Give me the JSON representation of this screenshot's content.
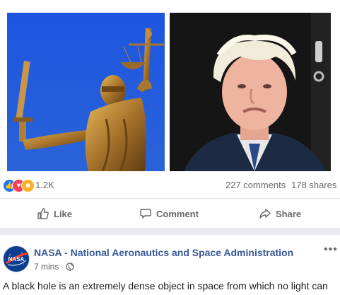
{
  "post": {
    "reactions": {
      "icons": [
        "like-reaction",
        "love-reaction",
        "haha-reaction"
      ],
      "count": "1.2K",
      "comments": "227 comments",
      "shares": "178 shares"
    },
    "actions": {
      "like": "Like",
      "comment": "Comment",
      "share": "Share"
    }
  },
  "next_post": {
    "author": "NASA - National Aeronautics and Space Administration",
    "time": "7 mins",
    "separator": "·",
    "body": "A black hole is an extremely dense object in space from which no light can"
  },
  "colors": {
    "link": "#385898",
    "like": "#1877f2",
    "love": "#f33e58",
    "haha": "#f7b125",
    "muted": "#65676b"
  }
}
